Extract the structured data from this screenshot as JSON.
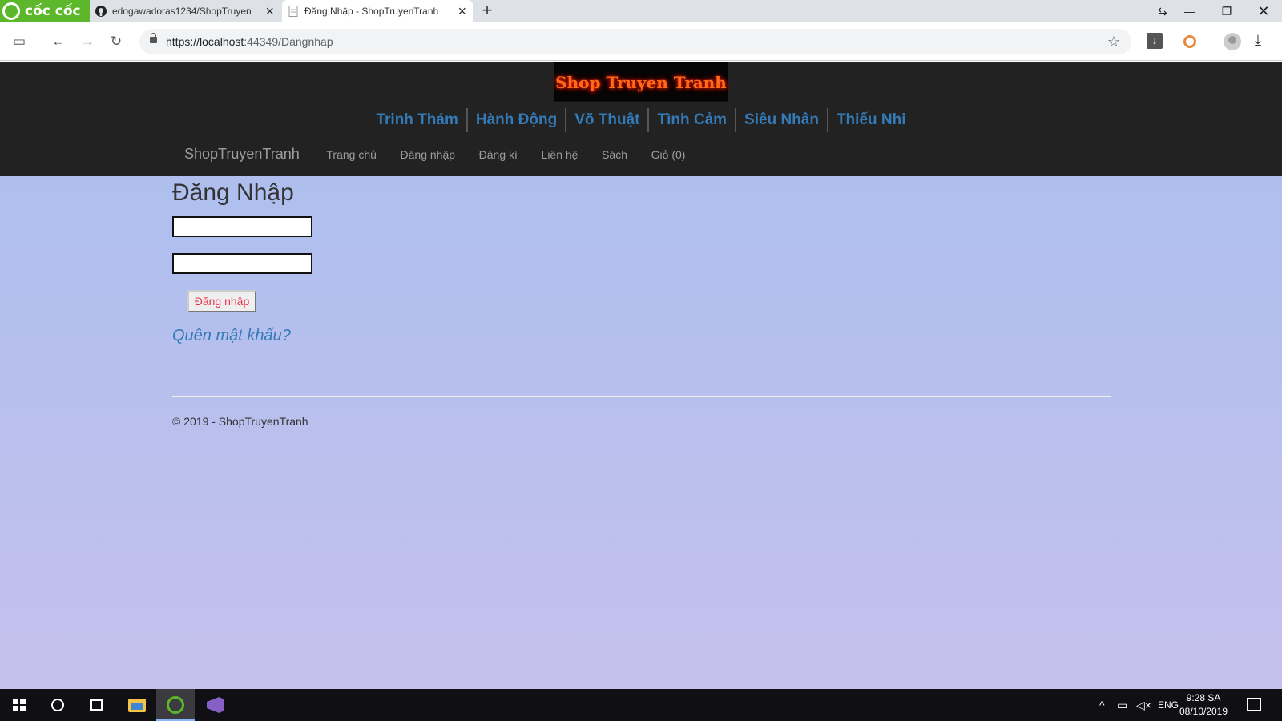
{
  "browser": {
    "brand": "cốc cốc",
    "tabs": [
      {
        "title": "edogawadoras1234/ShopTruyenTr",
        "icon": "github-icon"
      },
      {
        "title": "Đăng Nhập - ShopTruyenTranh",
        "icon": "document-icon"
      }
    ],
    "url_host": "https://localhost",
    "url_path": ":44349/Dangnhap"
  },
  "site": {
    "logo_text": "Shop Truyen Tranh",
    "genres": [
      "Trinh Thám",
      "Hành Động",
      "Võ Thuật",
      "Tình Cảm",
      "Siêu Nhân",
      "Thiếu Nhi"
    ],
    "brand": "ShopTruyenTranh",
    "nav": [
      "Trang chủ",
      "Đăng nhập",
      "Đăng kí",
      "Liên hệ",
      "Sách",
      "Giỏ (0)"
    ]
  },
  "login": {
    "title": "Đăng Nhập",
    "username_value": "",
    "password_value": "",
    "submit_label": "Đăng nhập",
    "forgot_label": "Quên mật khẩu?"
  },
  "footer": {
    "text": "© 2019 - ShopTruyenTranh"
  },
  "taskbar": {
    "language": "ENG",
    "time": "9:28 SA",
    "date": "08/10/2019"
  },
  "colors": {
    "header_bg": "#222222",
    "genre_link": "#337ab7",
    "brand_green": "#5cb82a",
    "button_text": "#e8334a"
  }
}
